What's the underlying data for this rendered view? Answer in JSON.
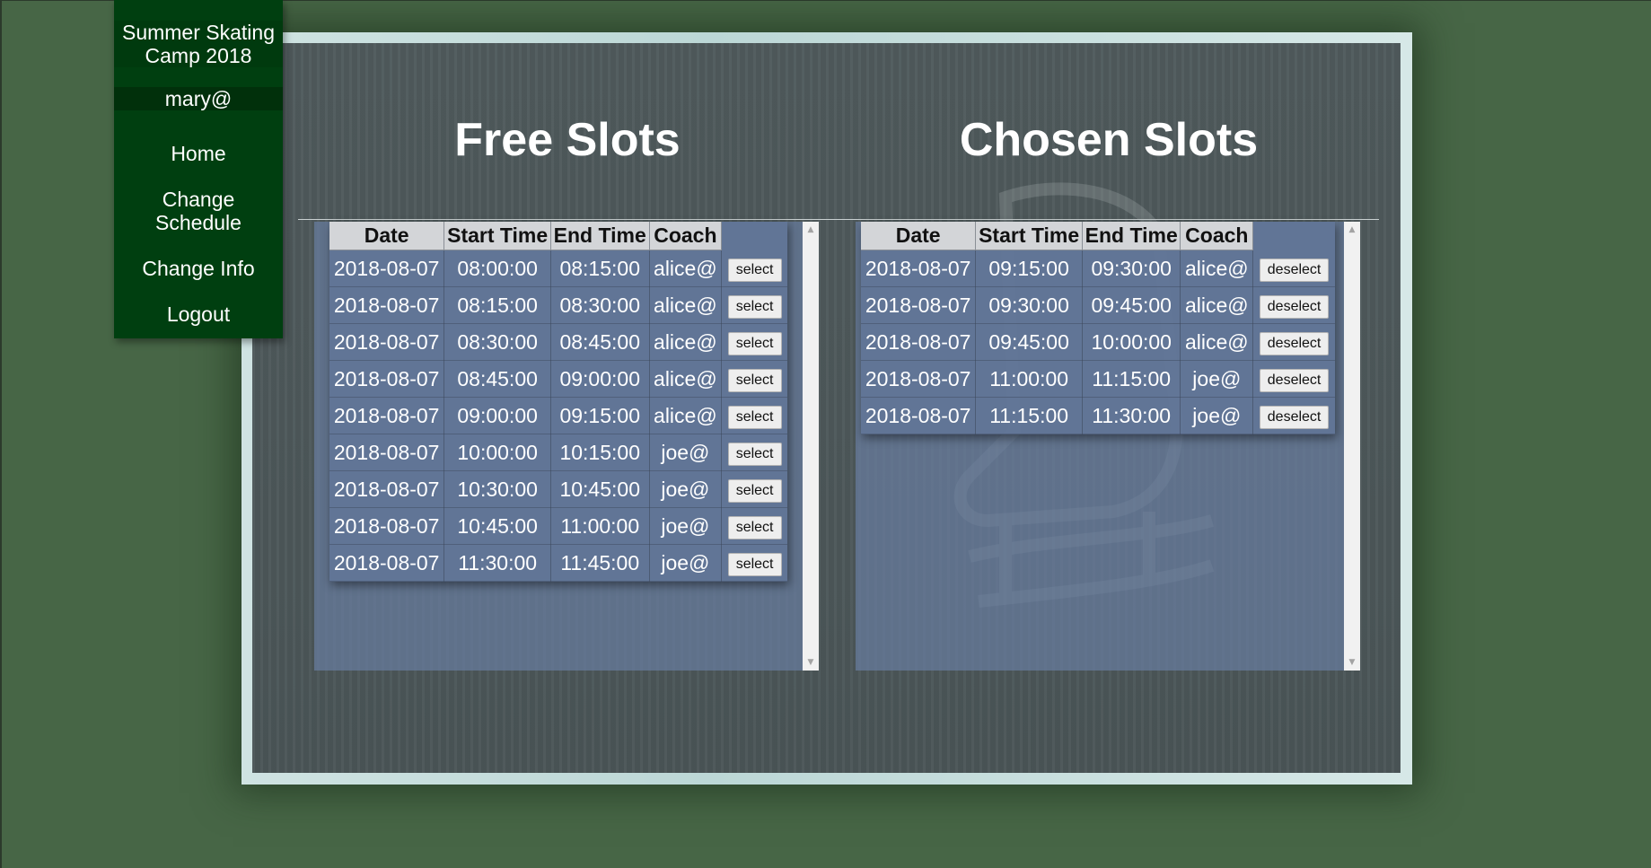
{
  "sidebar": {
    "title_line1": "Summer Skating",
    "title_line2": "Camp 2018",
    "user": "mary@",
    "nav": {
      "home": "Home",
      "change_schedule_line1": "Change",
      "change_schedule_line2": "Schedule",
      "change_info": "Change Info",
      "logout": "Logout"
    }
  },
  "free_slots": {
    "heading": "Free Slots",
    "columns": [
      "Date",
      "Start Time",
      "End Time",
      "Coach"
    ],
    "button_label": "select",
    "rows": [
      {
        "date": "2018-08-07",
        "start": "08:00:00",
        "end": "08:15:00",
        "coach": "alice@"
      },
      {
        "date": "2018-08-07",
        "start": "08:15:00",
        "end": "08:30:00",
        "coach": "alice@"
      },
      {
        "date": "2018-08-07",
        "start": "08:30:00",
        "end": "08:45:00",
        "coach": "alice@"
      },
      {
        "date": "2018-08-07",
        "start": "08:45:00",
        "end": "09:00:00",
        "coach": "alice@"
      },
      {
        "date": "2018-08-07",
        "start": "09:00:00",
        "end": "09:15:00",
        "coach": "alice@"
      },
      {
        "date": "2018-08-07",
        "start": "10:00:00",
        "end": "10:15:00",
        "coach": "joe@"
      },
      {
        "date": "2018-08-07",
        "start": "10:30:00",
        "end": "10:45:00",
        "coach": "joe@"
      },
      {
        "date": "2018-08-07",
        "start": "10:45:00",
        "end": "11:00:00",
        "coach": "joe@"
      },
      {
        "date": "2018-08-07",
        "start": "11:30:00",
        "end": "11:45:00",
        "coach": "joe@"
      }
    ]
  },
  "chosen_slots": {
    "heading": "Chosen Slots",
    "columns": [
      "Date",
      "Start Time",
      "End Time",
      "Coach"
    ],
    "button_label": "deselect",
    "rows": [
      {
        "date": "2018-08-07",
        "start": "09:15:00",
        "end": "09:30:00",
        "coach": "alice@"
      },
      {
        "date": "2018-08-07",
        "start": "09:30:00",
        "end": "09:45:00",
        "coach": "alice@"
      },
      {
        "date": "2018-08-07",
        "start": "09:45:00",
        "end": "10:00:00",
        "coach": "alice@"
      },
      {
        "date": "2018-08-07",
        "start": "11:00:00",
        "end": "11:15:00",
        "coach": "joe@"
      },
      {
        "date": "2018-08-07",
        "start": "11:15:00",
        "end": "11:30:00",
        "coach": "joe@"
      }
    ]
  },
  "icons": {
    "scroll_up": "scroll-up-arrow-icon",
    "scroll_down": "scroll-down-arrow-icon"
  },
  "colors": {
    "page_background": "#476646",
    "sidebar_background": "#003f10",
    "table_header": "#d3d5d8",
    "slot_panel": "#687da0"
  }
}
